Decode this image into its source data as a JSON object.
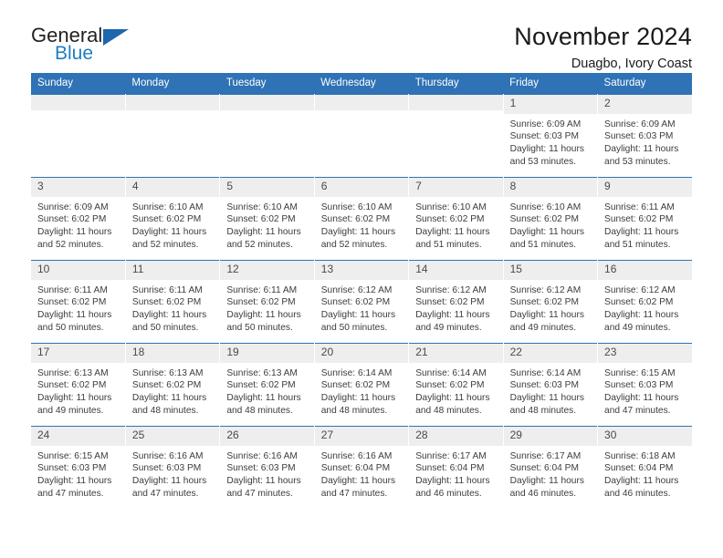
{
  "logo": {
    "word_general": "General",
    "word_blue": "Blue",
    "triangle_color": "#1c67ad",
    "blue_text_color": "#1d7fc3"
  },
  "header": {
    "title": "November 2024",
    "subtitle": "Duagbo, Ivory Coast"
  },
  "theme": {
    "header_row_color": "#2f72b5",
    "daynum_strip_color": "#eeeeee",
    "text_color": "#3c3c3c"
  },
  "weekday_headers": [
    "Sunday",
    "Monday",
    "Tuesday",
    "Wednesday",
    "Thursday",
    "Friday",
    "Saturday"
  ],
  "labels": {
    "sunrise_prefix": "Sunrise: ",
    "sunset_prefix": "Sunset: ",
    "daylight_prefix": "Daylight: "
  },
  "weeks": [
    [
      {
        "day": "",
        "empty": true
      },
      {
        "day": "",
        "empty": true
      },
      {
        "day": "",
        "empty": true
      },
      {
        "day": "",
        "empty": true
      },
      {
        "day": "",
        "empty": true
      },
      {
        "day": "1",
        "sunrise": "Sunrise: 6:09 AM",
        "sunset": "Sunset: 6:03 PM",
        "daylight": "Daylight: 11 hours and 53 minutes."
      },
      {
        "day": "2",
        "sunrise": "Sunrise: 6:09 AM",
        "sunset": "Sunset: 6:03 PM",
        "daylight": "Daylight: 11 hours and 53 minutes."
      }
    ],
    [
      {
        "day": "3",
        "sunrise": "Sunrise: 6:09 AM",
        "sunset": "Sunset: 6:02 PM",
        "daylight": "Daylight: 11 hours and 52 minutes."
      },
      {
        "day": "4",
        "sunrise": "Sunrise: 6:10 AM",
        "sunset": "Sunset: 6:02 PM",
        "daylight": "Daylight: 11 hours and 52 minutes."
      },
      {
        "day": "5",
        "sunrise": "Sunrise: 6:10 AM",
        "sunset": "Sunset: 6:02 PM",
        "daylight": "Daylight: 11 hours and 52 minutes."
      },
      {
        "day": "6",
        "sunrise": "Sunrise: 6:10 AM",
        "sunset": "Sunset: 6:02 PM",
        "daylight": "Daylight: 11 hours and 52 minutes."
      },
      {
        "day": "7",
        "sunrise": "Sunrise: 6:10 AM",
        "sunset": "Sunset: 6:02 PM",
        "daylight": "Daylight: 11 hours and 51 minutes."
      },
      {
        "day": "8",
        "sunrise": "Sunrise: 6:10 AM",
        "sunset": "Sunset: 6:02 PM",
        "daylight": "Daylight: 11 hours and 51 minutes."
      },
      {
        "day": "9",
        "sunrise": "Sunrise: 6:11 AM",
        "sunset": "Sunset: 6:02 PM",
        "daylight": "Daylight: 11 hours and 51 minutes."
      }
    ],
    [
      {
        "day": "10",
        "sunrise": "Sunrise: 6:11 AM",
        "sunset": "Sunset: 6:02 PM",
        "daylight": "Daylight: 11 hours and 50 minutes."
      },
      {
        "day": "11",
        "sunrise": "Sunrise: 6:11 AM",
        "sunset": "Sunset: 6:02 PM",
        "daylight": "Daylight: 11 hours and 50 minutes."
      },
      {
        "day": "12",
        "sunrise": "Sunrise: 6:11 AM",
        "sunset": "Sunset: 6:02 PM",
        "daylight": "Daylight: 11 hours and 50 minutes."
      },
      {
        "day": "13",
        "sunrise": "Sunrise: 6:12 AM",
        "sunset": "Sunset: 6:02 PM",
        "daylight": "Daylight: 11 hours and 50 minutes."
      },
      {
        "day": "14",
        "sunrise": "Sunrise: 6:12 AM",
        "sunset": "Sunset: 6:02 PM",
        "daylight": "Daylight: 11 hours and 49 minutes."
      },
      {
        "day": "15",
        "sunrise": "Sunrise: 6:12 AM",
        "sunset": "Sunset: 6:02 PM",
        "daylight": "Daylight: 11 hours and 49 minutes."
      },
      {
        "day": "16",
        "sunrise": "Sunrise: 6:12 AM",
        "sunset": "Sunset: 6:02 PM",
        "daylight": "Daylight: 11 hours and 49 minutes."
      }
    ],
    [
      {
        "day": "17",
        "sunrise": "Sunrise: 6:13 AM",
        "sunset": "Sunset: 6:02 PM",
        "daylight": "Daylight: 11 hours and 49 minutes."
      },
      {
        "day": "18",
        "sunrise": "Sunrise: 6:13 AM",
        "sunset": "Sunset: 6:02 PM",
        "daylight": "Daylight: 11 hours and 48 minutes."
      },
      {
        "day": "19",
        "sunrise": "Sunrise: 6:13 AM",
        "sunset": "Sunset: 6:02 PM",
        "daylight": "Daylight: 11 hours and 48 minutes."
      },
      {
        "day": "20",
        "sunrise": "Sunrise: 6:14 AM",
        "sunset": "Sunset: 6:02 PM",
        "daylight": "Daylight: 11 hours and 48 minutes."
      },
      {
        "day": "21",
        "sunrise": "Sunrise: 6:14 AM",
        "sunset": "Sunset: 6:02 PM",
        "daylight": "Daylight: 11 hours and 48 minutes."
      },
      {
        "day": "22",
        "sunrise": "Sunrise: 6:14 AM",
        "sunset": "Sunset: 6:03 PM",
        "daylight": "Daylight: 11 hours and 48 minutes."
      },
      {
        "day": "23",
        "sunrise": "Sunrise: 6:15 AM",
        "sunset": "Sunset: 6:03 PM",
        "daylight": "Daylight: 11 hours and 47 minutes."
      }
    ],
    [
      {
        "day": "24",
        "sunrise": "Sunrise: 6:15 AM",
        "sunset": "Sunset: 6:03 PM",
        "daylight": "Daylight: 11 hours and 47 minutes."
      },
      {
        "day": "25",
        "sunrise": "Sunrise: 6:16 AM",
        "sunset": "Sunset: 6:03 PM",
        "daylight": "Daylight: 11 hours and 47 minutes."
      },
      {
        "day": "26",
        "sunrise": "Sunrise: 6:16 AM",
        "sunset": "Sunset: 6:03 PM",
        "daylight": "Daylight: 11 hours and 47 minutes."
      },
      {
        "day": "27",
        "sunrise": "Sunrise: 6:16 AM",
        "sunset": "Sunset: 6:04 PM",
        "daylight": "Daylight: 11 hours and 47 minutes."
      },
      {
        "day": "28",
        "sunrise": "Sunrise: 6:17 AM",
        "sunset": "Sunset: 6:04 PM",
        "daylight": "Daylight: 11 hours and 46 minutes."
      },
      {
        "day": "29",
        "sunrise": "Sunrise: 6:17 AM",
        "sunset": "Sunset: 6:04 PM",
        "daylight": "Daylight: 11 hours and 46 minutes."
      },
      {
        "day": "30",
        "sunrise": "Sunrise: 6:18 AM",
        "sunset": "Sunset: 6:04 PM",
        "daylight": "Daylight: 11 hours and 46 minutes."
      }
    ]
  ]
}
